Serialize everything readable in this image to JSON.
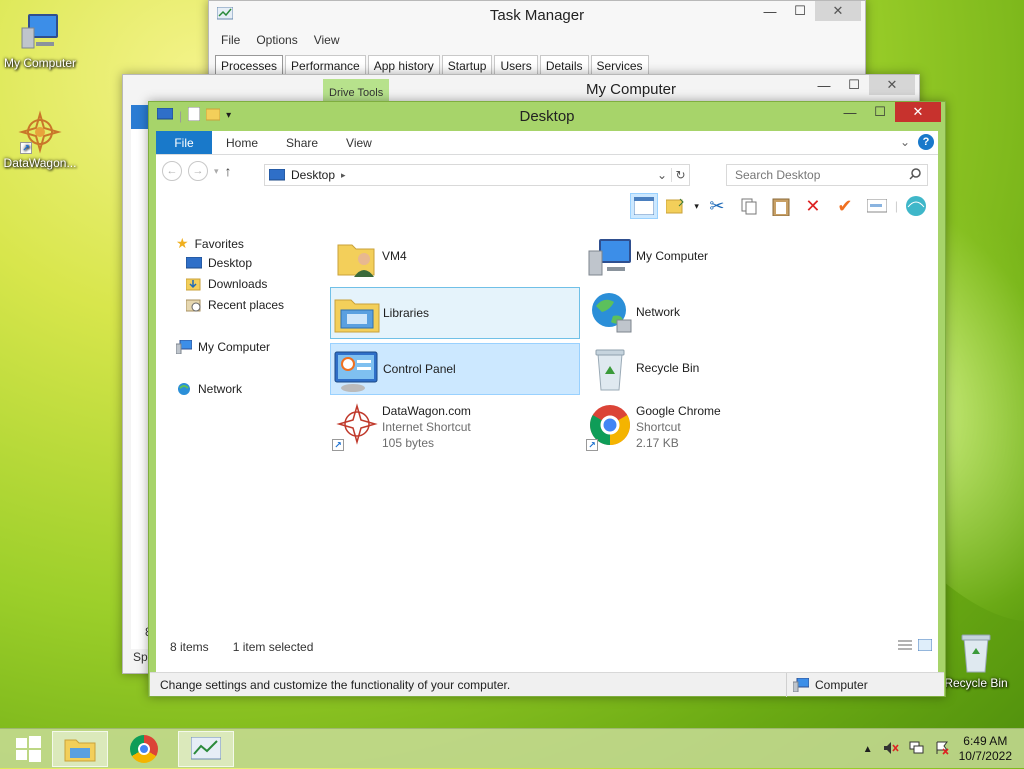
{
  "desktop": {
    "icons": [
      {
        "label": "My Computer",
        "icon": "computer-icon"
      },
      {
        "label": "DataWagon...",
        "icon": "datawagon-icon"
      },
      {
        "label": "Recycle Bin",
        "icon": "recycle-bin-icon"
      }
    ]
  },
  "task_manager": {
    "title": "Task Manager",
    "menu": [
      "File",
      "Options",
      "View"
    ],
    "tabs": [
      "Processes",
      "Performance",
      "App history",
      "Startup",
      "Users",
      "Details",
      "Services"
    ],
    "active_tab": "Processes"
  },
  "my_computer_window": {
    "title": "My Computer",
    "context_tab": "Drive Tools",
    "status_fragment_count": "8",
    "status_fragment_text": "Spa"
  },
  "explorer": {
    "title": "Desktop",
    "ribbon": {
      "file": "File",
      "tabs": [
        "Home",
        "Share",
        "View"
      ]
    },
    "address": {
      "location": "Desktop"
    },
    "search": {
      "placeholder": "Search Desktop"
    },
    "nav_pane": {
      "favorites": "Favorites",
      "favorite_items": [
        "Desktop",
        "Downloads",
        "Recent places"
      ],
      "my_computer": "My Computer",
      "network": "Network"
    },
    "items": [
      {
        "name": "VM4",
        "icon": "user-folder-icon"
      },
      {
        "name": "My Computer",
        "icon": "computer-icon"
      },
      {
        "name": "Libraries",
        "icon": "libraries-icon"
      },
      {
        "name": "Network",
        "icon": "network-globe-icon"
      },
      {
        "name": "Control Panel",
        "icon": "control-panel-icon"
      },
      {
        "name": "Recycle Bin",
        "icon": "recycle-bin-icon"
      },
      {
        "name": "DataWagon.com",
        "type": "Internet Shortcut",
        "size": "105 bytes",
        "icon": "datawagon-icon"
      },
      {
        "name": "Google Chrome",
        "type": "Shortcut",
        "size": "2.17 KB",
        "icon": "chrome-icon"
      }
    ],
    "status": {
      "count": "8 items",
      "selection": "1 item selected"
    },
    "infobar": {
      "description": "Change settings and customize the functionality of your computer.",
      "location": "Computer"
    }
  },
  "taskbar": {
    "clock_time": "6:49 AM",
    "clock_date": "10/7/2022"
  }
}
